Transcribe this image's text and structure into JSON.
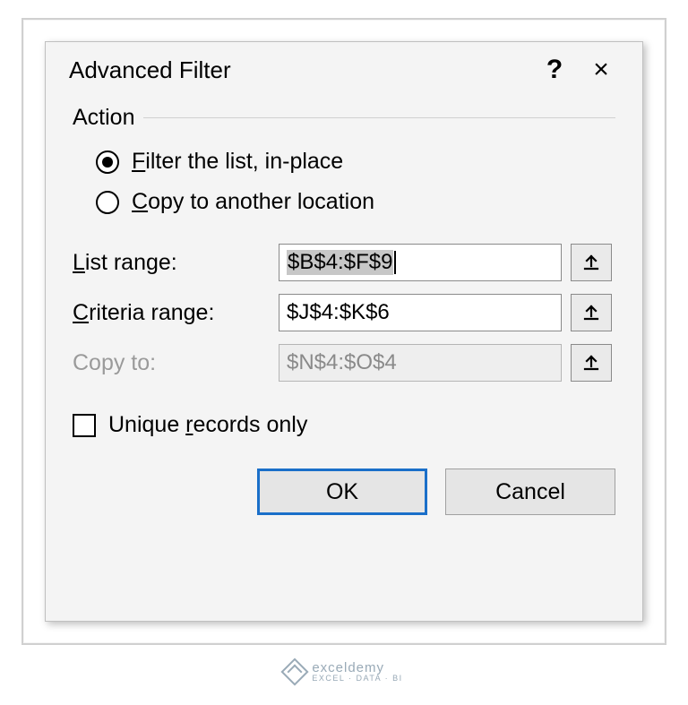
{
  "dialog": {
    "title": "Advanced Filter",
    "help_symbol": "?",
    "close_symbol": "×"
  },
  "action": {
    "group_label": "Action",
    "options": [
      {
        "label_pre": "",
        "label_u": "F",
        "label_post": "ilter the list, in-place",
        "checked": true
      },
      {
        "label_pre": "",
        "label_u": "C",
        "label_post": "opy to another location",
        "checked": false
      }
    ]
  },
  "fields": {
    "list_range": {
      "label_u": "L",
      "label_post": "ist range:",
      "value": "$B$4:$F$9",
      "enabled": true,
      "focused": true
    },
    "criteria_range": {
      "label_u": "C",
      "label_post": "riteria range:",
      "value": "$J$4:$K$6",
      "enabled": true,
      "focused": false
    },
    "copy_to": {
      "label_plain": "Copy to:",
      "value": "$N$4:$O$4",
      "enabled": false,
      "focused": false
    }
  },
  "unique": {
    "label_pre": "Unique ",
    "label_u": "r",
    "label_post": "ecords only",
    "checked": false
  },
  "buttons": {
    "ok": "OK",
    "cancel": "Cancel"
  },
  "watermark": {
    "name": "exceldemy",
    "tagline": "EXCEL · DATA · BI"
  }
}
